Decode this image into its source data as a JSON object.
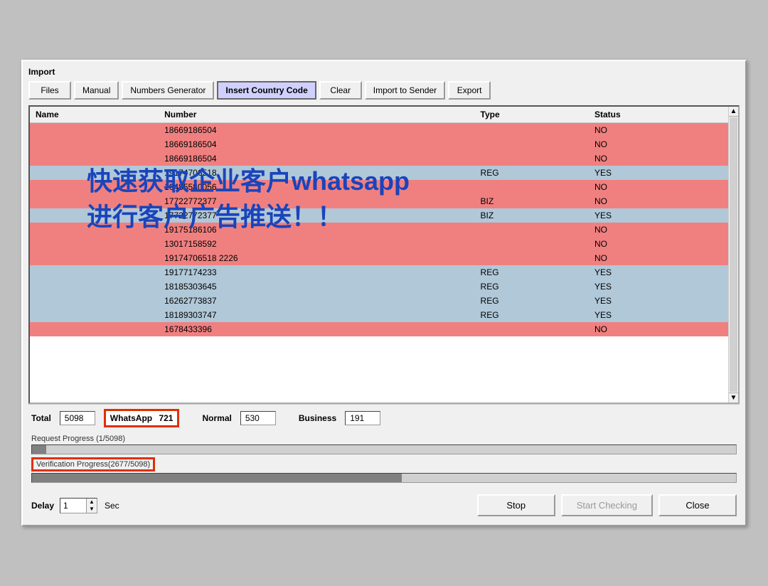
{
  "window": {
    "section_label": "Import"
  },
  "toolbar": {
    "buttons": [
      {
        "id": "files",
        "label": "Files",
        "active": false
      },
      {
        "id": "manual",
        "label": "Manual",
        "active": false
      },
      {
        "id": "numbers-generator",
        "label": "Numbers Generator",
        "active": false
      },
      {
        "id": "insert-country-code",
        "label": "Insert Country Code",
        "active": true
      },
      {
        "id": "clear",
        "label": "Clear",
        "active": false
      },
      {
        "id": "import-to-sender",
        "label": "Import to Sender",
        "active": false
      },
      {
        "id": "export",
        "label": "Export",
        "active": false
      }
    ]
  },
  "table": {
    "columns": [
      "Name",
      "Number",
      "Type",
      "Status"
    ],
    "rows": [
      {
        "name": "",
        "number": "18669186504",
        "type": "",
        "status": "NO",
        "color": "pink"
      },
      {
        "name": "",
        "number": "18669186504",
        "type": "",
        "status": "NO",
        "color": "pink"
      },
      {
        "name": "",
        "number": "18669186504",
        "type": "",
        "status": "NO",
        "color": "pink"
      },
      {
        "name": "",
        "number": "19174706518",
        "type": "REG",
        "status": "YES",
        "color": "blue"
      },
      {
        "name": "",
        "number": "10485580056",
        "type": "",
        "status": "NO",
        "color": "pink"
      },
      {
        "name": "",
        "number": "17722772377",
        "type": "BIZ",
        "status": "NO",
        "color": "pink"
      },
      {
        "name": "",
        "number": "17722772377",
        "type": "BIZ",
        "status": "YES",
        "color": "blue"
      },
      {
        "name": "",
        "number": "19175186106",
        "type": "",
        "status": "NO",
        "color": "pink"
      },
      {
        "name": "",
        "number": "13017158592",
        "type": "",
        "status": "NO",
        "color": "pink"
      },
      {
        "name": "",
        "number": "19174706518 2226",
        "type": "",
        "status": "NO",
        "color": "pink"
      },
      {
        "name": "",
        "number": "19177174233",
        "type": "REG",
        "status": "YES",
        "color": "blue"
      },
      {
        "name": "",
        "number": "18185303645",
        "type": "REG",
        "status": "YES",
        "color": "blue"
      },
      {
        "name": "",
        "number": "16262773837",
        "type": "REG",
        "status": "YES",
        "color": "blue"
      },
      {
        "name": "",
        "number": "18189303747",
        "type": "REG",
        "status": "YES",
        "color": "blue"
      },
      {
        "name": "",
        "number": "1678433396",
        "type": "",
        "status": "NO",
        "color": "pink"
      }
    ]
  },
  "watermark": {
    "line1": "快速获取企业客户whatsapp",
    "line2": "进行客户广告推送！！"
  },
  "stats": {
    "total_label": "Total",
    "total_value": "5098",
    "whatsapp_label": "WhatsApp",
    "whatsapp_value": "721",
    "normal_label": "Normal",
    "normal_value": "530",
    "business_label": "Business",
    "business_value": "191"
  },
  "progress": {
    "request_label": "Request Progress (1/5098)",
    "request_fill": 0.02,
    "verification_label": "Verification Progress(2677/5098)",
    "verification_fill": 0.525
  },
  "delay": {
    "label": "Delay",
    "value": "1",
    "unit": "Sec"
  },
  "buttons": {
    "stop_label": "Stop",
    "start_checking_label": "Start Checking",
    "close_label": "Close"
  }
}
